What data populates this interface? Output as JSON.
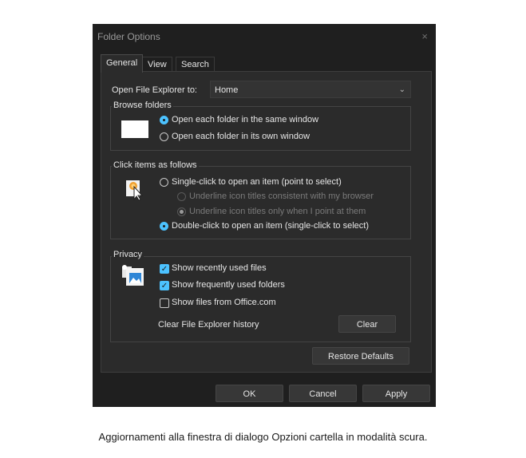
{
  "window": {
    "title": "Folder Options",
    "close_glyph": "×"
  },
  "tabs": [
    {
      "label": "General"
    },
    {
      "label": "View"
    },
    {
      "label": "Search"
    }
  ],
  "open_explorer": {
    "label": "Open File Explorer to:",
    "value": "Home",
    "chevron": "⌄"
  },
  "browse_folders": {
    "title": "Browse folders",
    "options": [
      {
        "label": "Open each folder in the same window",
        "selected": true
      },
      {
        "label": "Open each folder in its own window",
        "selected": false
      }
    ]
  },
  "click_items": {
    "title": "Click items as follows",
    "single": {
      "label": "Single-click to open an item (point to select)",
      "selected": false
    },
    "sub_options": [
      {
        "label": "Underline icon titles consistent with my browser",
        "selected": false,
        "enabled": false
      },
      {
        "label": "Underline icon titles only when I point at them",
        "selected": true,
        "enabled": false
      }
    ],
    "double": {
      "label": "Double-click to open an item (single-click to select)",
      "selected": true
    }
  },
  "privacy": {
    "title": "Privacy",
    "checks": [
      {
        "label": "Show recently used files",
        "checked": true
      },
      {
        "label": "Show frequently used folders",
        "checked": true
      },
      {
        "label": "Show files from Office.com",
        "checked": false
      }
    ],
    "clear_label": "Clear File Explorer history",
    "clear_button": "Clear",
    "check_glyph": "✓"
  },
  "restore_defaults": "Restore Defaults",
  "footer": {
    "ok": "OK",
    "cancel": "Cancel",
    "apply": "Apply"
  },
  "caption": "Aggiornamenti alla finestra di dialogo Opzioni cartella in modalità scura.",
  "colors": {
    "accent": "#4cc2ff",
    "dialog_bg": "#1f1f1f",
    "panel_bg": "#2b2b2b"
  }
}
